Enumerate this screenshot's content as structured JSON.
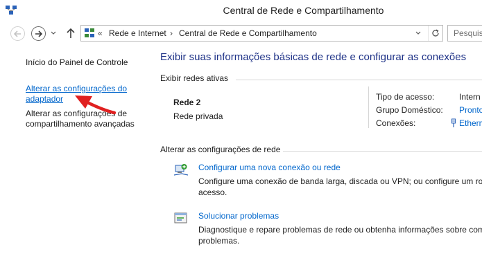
{
  "window": {
    "title": "Central de Rede e Compartilhamento"
  },
  "address_bar": {
    "overflow": "«",
    "segments": [
      "Rede e Internet",
      "Central de Rede e Compartilhamento"
    ],
    "separator": "›"
  },
  "search": {
    "placeholder": "Pesquis"
  },
  "sidebar": {
    "items": [
      {
        "label_lines": [
          "Início do Painel de Controle"
        ]
      },
      {
        "label_lines": [
          "Alterar as configurações do",
          "adaptador"
        ],
        "active": true
      },
      {
        "label_lines": [
          "Alterar as configurações de",
          "compartilhamento avançadas"
        ]
      }
    ]
  },
  "main": {
    "heading": "Exibir suas informações básicas de rede e configurar as conexões",
    "active_networks": {
      "title": "Exibir redes ativas",
      "network_name": "Rede  2",
      "network_type": "Rede privada",
      "properties": [
        {
          "label": "Tipo de acesso:",
          "value": "Intern",
          "is_link": false
        },
        {
          "label": "Grupo Doméstico:",
          "value": "Pronto",
          "is_link": true
        },
        {
          "label": "Conexões:",
          "value": "Etherm",
          "is_link": true
        }
      ]
    },
    "change_settings": {
      "title": "Alterar as configurações de rede",
      "tasks": [
        {
          "icon": "new-connection-icon",
          "link": "Configurar uma nova conexão ou rede",
          "description_lines": [
            "Configure uma conexão de banda larga, discada ou VPN; ou configure um rot",
            "acesso."
          ]
        },
        {
          "icon": "troubleshoot-icon",
          "link": "Solucionar problemas",
          "description_lines": [
            "Diagnostique e repare problemas de rede ou obtenha informações sobre com",
            "problemas."
          ]
        }
      ]
    }
  },
  "colors": {
    "link": "#0066cc",
    "heading": "#1e3287",
    "annotation_arrow": "#e02020"
  }
}
